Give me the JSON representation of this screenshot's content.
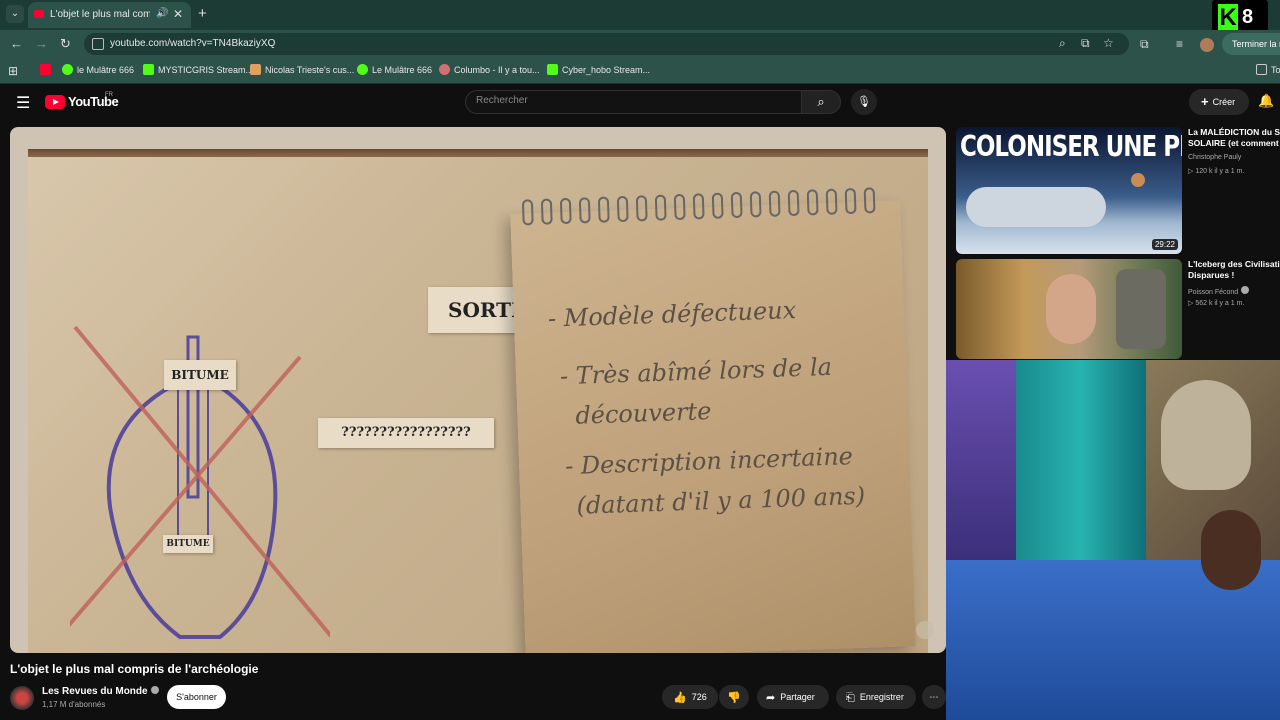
{
  "browser": {
    "tab_title": "L'objet le plus mal compris",
    "url": "youtube.com/watch?v=TN4BkaziyXQ",
    "finish_button": "Terminer la m",
    "bookmarks": [
      {
        "label": "",
        "color": "#ff0033"
      },
      {
        "label": "le Mulâtre 666",
        "color": "#53fc18"
      },
      {
        "label": "MYSTICGRIS Stream...",
        "color": "#53fc18"
      },
      {
        "label": "Nicolas Trieste's cus...",
        "color": "#e0a060"
      },
      {
        "label": "Le Mulâtre 666",
        "color": "#53fc18"
      },
      {
        "label": "Columbo - Il y a tou...",
        "color": "#d07070"
      },
      {
        "label": "Cyber_hobo Stream...",
        "color": "#53fc18"
      }
    ],
    "bookmarks_folder": "To"
  },
  "overlay": {
    "logo_letter": "K",
    "logo_number": "8"
  },
  "youtube": {
    "logo_text": "YouTube",
    "country_code": "FR",
    "search_placeholder": "Rechercher",
    "create_label": "Créer"
  },
  "video": {
    "title": "L'objet le plus mal compris de l'archéologie",
    "channel": "Les Revues du Monde",
    "subscribers": "1,17 M d'abonnés",
    "subscribe_label": "S'abonner",
    "likes": "726",
    "share_label": "Partager",
    "save_label": "Enregistrer",
    "frame": {
      "label_sortie": "SORTI",
      "label_bitume_top": "BITUME",
      "label_bitume_bottom": "BITUME",
      "label_unknown": "?????????????????",
      "notes": [
        "- Modèle défectueux",
        "- Très abîmé lors de la",
        "découverte",
        "- Description incertaine",
        "(datant d'il y a 100 ans)"
      ]
    }
  },
  "recommendations": [
    {
      "thumb_headline": "COLONISER UNE PLANÈTE",
      "title_line1": "La MALÉDICTION du SY",
      "title_line2": "SOLAIRE (et comment l",
      "channel": "Christophe Pauly",
      "meta": "▷ 120 k  il y a 1 m.",
      "duration": "29:22"
    },
    {
      "title_line1": "L'Iceberg des Civilisatio",
      "title_line2": "Disparues !",
      "channel": "Poisson Fécond",
      "meta": "▷ 562 k  il y a 1 m."
    }
  ]
}
